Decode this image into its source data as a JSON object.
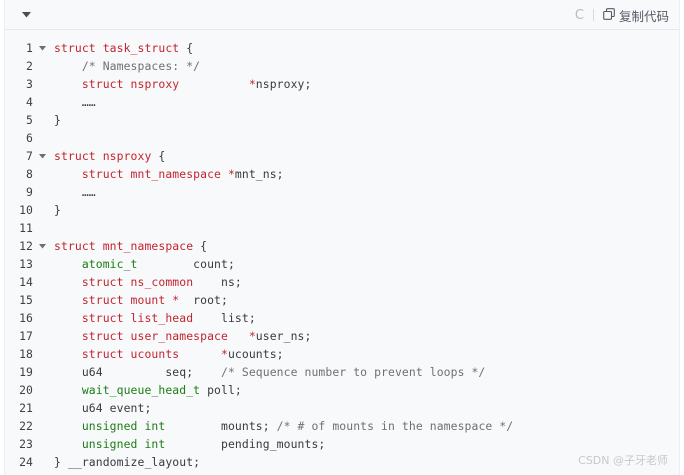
{
  "toolbar": {
    "run_icon": "C",
    "copy_label": "复制代码"
  },
  "code_lines": [
    {
      "n": "1",
      "fold": true,
      "tokens": [
        [
          "kw",
          "struct task_struct "
        ],
        [
          "pl",
          "{"
        ]
      ]
    },
    {
      "n": "2",
      "fold": false,
      "tokens": [
        [
          "pl",
          "    "
        ],
        [
          "cm",
          "/* Namespaces: */"
        ]
      ]
    },
    {
      "n": "3",
      "fold": false,
      "tokens": [
        [
          "pl",
          "    "
        ],
        [
          "kw",
          "struct nsproxy          *"
        ],
        [
          "pl",
          "nsproxy;"
        ]
      ]
    },
    {
      "n": "4",
      "fold": false,
      "tokens": [
        [
          "pl",
          "    ……"
        ]
      ]
    },
    {
      "n": "5",
      "fold": false,
      "tokens": [
        [
          "pl",
          "}"
        ]
      ]
    },
    {
      "n": "6",
      "fold": false,
      "tokens": []
    },
    {
      "n": "7",
      "fold": true,
      "tokens": [
        [
          "kw",
          "struct nsproxy "
        ],
        [
          "pl",
          "{"
        ]
      ]
    },
    {
      "n": "8",
      "fold": false,
      "tokens": [
        [
          "pl",
          "    "
        ],
        [
          "kw",
          "struct mnt_namespace *"
        ],
        [
          "pl",
          "mnt_ns;"
        ]
      ]
    },
    {
      "n": "9",
      "fold": false,
      "tokens": [
        [
          "pl",
          "    ……"
        ]
      ]
    },
    {
      "n": "10",
      "fold": false,
      "tokens": [
        [
          "pl",
          "}"
        ]
      ]
    },
    {
      "n": "11",
      "fold": false,
      "tokens": []
    },
    {
      "n": "12",
      "fold": true,
      "tokens": [
        [
          "kw",
          "struct mnt_namespace "
        ],
        [
          "pl",
          "{"
        ]
      ]
    },
    {
      "n": "13",
      "fold": false,
      "tokens": [
        [
          "pl",
          "    "
        ],
        [
          "ty",
          "atomic_t"
        ],
        [
          "pl",
          "        count;"
        ]
      ]
    },
    {
      "n": "14",
      "fold": false,
      "tokens": [
        [
          "pl",
          "    "
        ],
        [
          "kw",
          "struct ns_common    "
        ],
        [
          "pl",
          "ns;"
        ]
      ]
    },
    {
      "n": "15",
      "fold": false,
      "tokens": [
        [
          "pl",
          "    "
        ],
        [
          "kw",
          "struct mount *  "
        ],
        [
          "pl",
          "root;"
        ]
      ]
    },
    {
      "n": "16",
      "fold": false,
      "tokens": [
        [
          "pl",
          "    "
        ],
        [
          "kw",
          "struct list_head    "
        ],
        [
          "pl",
          "list;"
        ]
      ]
    },
    {
      "n": "17",
      "fold": false,
      "tokens": [
        [
          "pl",
          "    "
        ],
        [
          "kw",
          "struct user_namespace   *"
        ],
        [
          "pl",
          "user_ns;"
        ]
      ]
    },
    {
      "n": "18",
      "fold": false,
      "tokens": [
        [
          "pl",
          "    "
        ],
        [
          "kw",
          "struct ucounts      *"
        ],
        [
          "pl",
          "ucounts;"
        ]
      ]
    },
    {
      "n": "19",
      "fold": false,
      "tokens": [
        [
          "pl",
          "    u64         seq;    "
        ],
        [
          "cm",
          "/* Sequence number to prevent loops */"
        ]
      ]
    },
    {
      "n": "20",
      "fold": false,
      "tokens": [
        [
          "pl",
          "    "
        ],
        [
          "ty",
          "wait_queue_head_t"
        ],
        [
          "pl",
          " poll;"
        ]
      ]
    },
    {
      "n": "21",
      "fold": false,
      "tokens": [
        [
          "pl",
          "    u64 event;"
        ]
      ]
    },
    {
      "n": "22",
      "fold": false,
      "tokens": [
        [
          "pl",
          "    "
        ],
        [
          "ty",
          "unsigned int"
        ],
        [
          "pl",
          "        mounts; "
        ],
        [
          "cm",
          "/* # of mounts in the namespace */"
        ]
      ]
    },
    {
      "n": "23",
      "fold": false,
      "tokens": [
        [
          "pl",
          "    "
        ],
        [
          "ty",
          "unsigned int"
        ],
        [
          "pl",
          "        pending_mounts;"
        ]
      ]
    },
    {
      "n": "24",
      "fold": false,
      "tokens": [
        [
          "pl",
          "} __randomize_layout;"
        ]
      ]
    }
  ],
  "watermark": "CSDN @子牙老师",
  "colors": {
    "keyword": "#c2252f",
    "type": "#1b7d15",
    "comment": "#6f6f76",
    "plain": "#383a42",
    "background": "#f8f9fa"
  },
  "icons": [
    "collapse-chevron-icon",
    "run-icon",
    "copy-icon",
    "fold-arrow-icon"
  ]
}
